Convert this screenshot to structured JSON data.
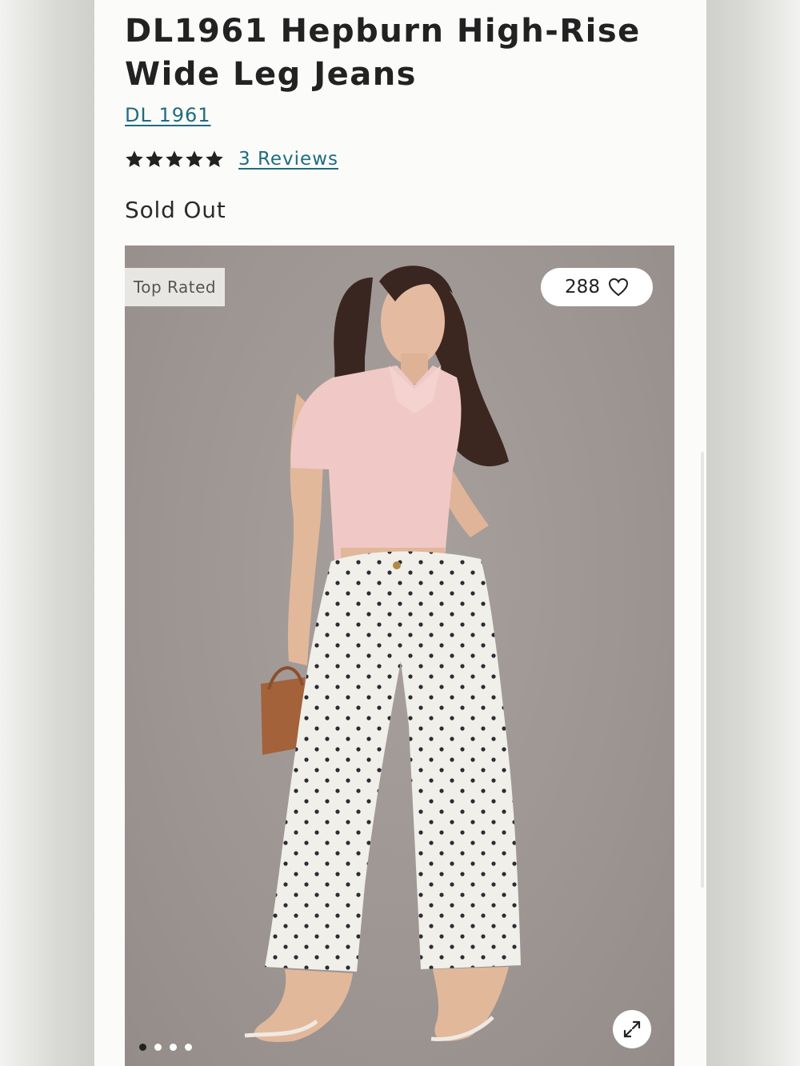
{
  "product": {
    "title_line1": "DL1961 Hepburn High-Rise",
    "title_line2": "Wide Leg Jeans",
    "brand": "DL 1961",
    "rating": 5,
    "reviews_link": "3 Reviews",
    "status": "Sold Out"
  },
  "gallery": {
    "badge": "Top Rated",
    "likes": "288",
    "heart_icon": "heart-outline-icon",
    "expand_icon": "expand-arrows-icon",
    "slide_count": 4,
    "active_slide": 1
  },
  "colors": {
    "link": "#1e6c80",
    "star": "#222222",
    "hero_background": "#9d9592"
  }
}
